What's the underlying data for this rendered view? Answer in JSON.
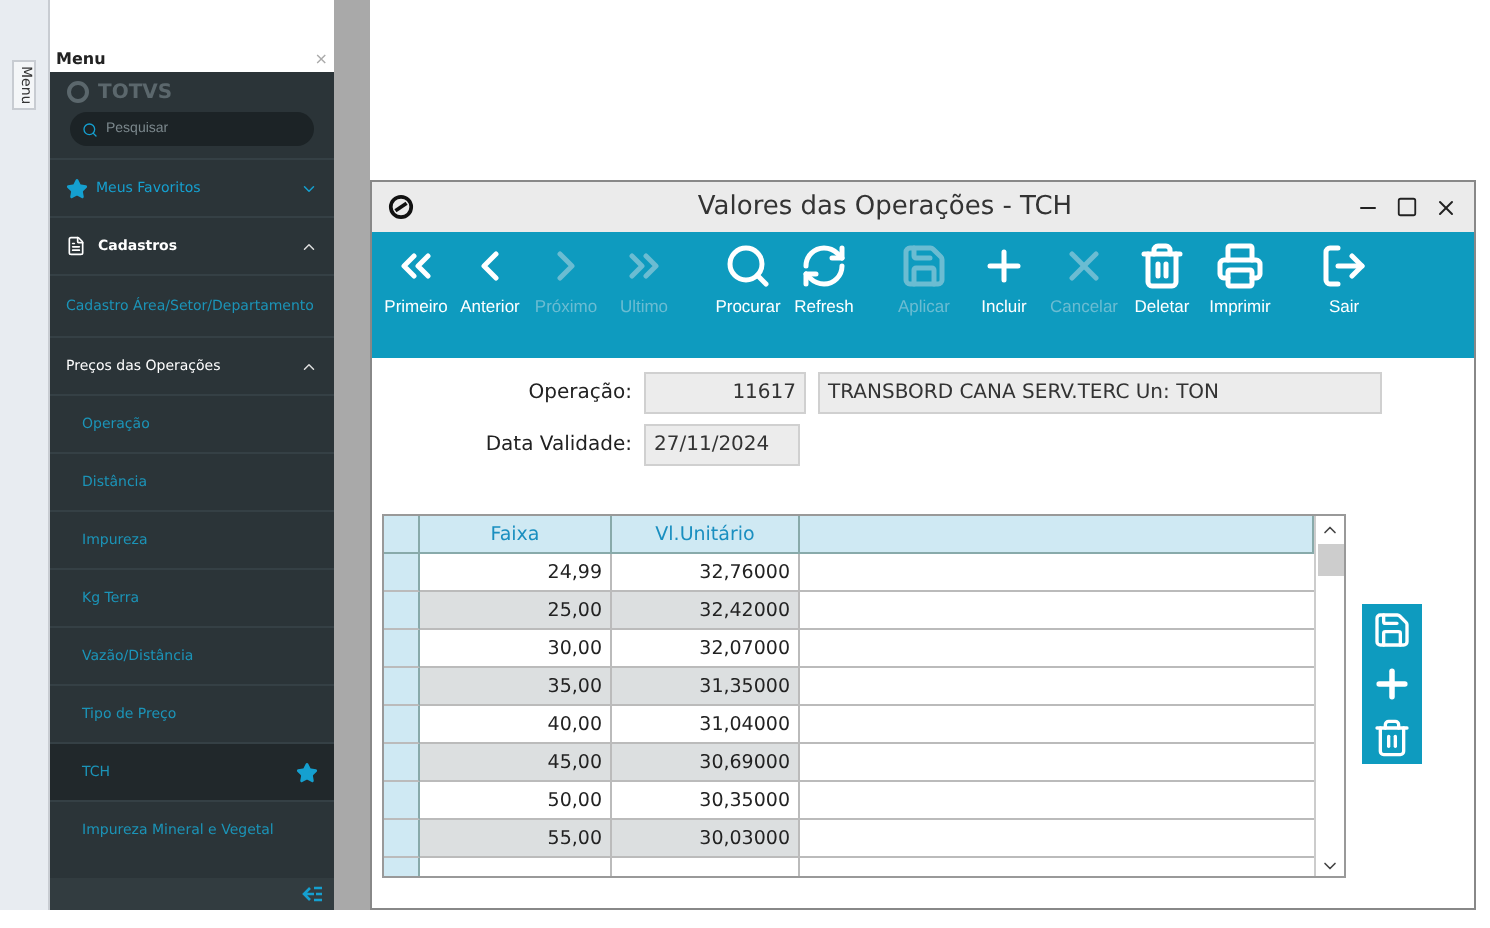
{
  "side_tab": {
    "label": "Menu"
  },
  "menu": {
    "title": "Menu",
    "close": "×",
    "logo": "TOTVS",
    "search": {
      "placeholder": "Pesquisar"
    },
    "items": [
      {
        "kind": "favorites",
        "label": "Meus Favoritos",
        "expanded": false
      },
      {
        "kind": "group",
        "label": "Cadastros",
        "expanded": true
      },
      {
        "kind": "link",
        "label": "Cadastro Área/Setor/Departamento",
        "selected": false,
        "favorite": false
      },
      {
        "kind": "section",
        "label": "Preços das Operações",
        "expanded": true
      },
      {
        "kind": "link",
        "label": "Operação",
        "selected": false,
        "favorite": false
      },
      {
        "kind": "link",
        "label": "Distância",
        "selected": false,
        "favorite": false
      },
      {
        "kind": "link",
        "label": "Impureza",
        "selected": false,
        "favorite": false
      },
      {
        "kind": "link",
        "label": "Kg Terra",
        "selected": false,
        "favorite": false
      },
      {
        "kind": "link",
        "label": "Vazão/Distância",
        "selected": false,
        "favorite": false
      },
      {
        "kind": "link",
        "label": "Tipo de Preço",
        "selected": false,
        "favorite": false
      },
      {
        "kind": "link",
        "label": "TCH",
        "selected": true,
        "favorite": true
      },
      {
        "kind": "link",
        "label": "Impureza Mineral e Vegetal",
        "selected": false,
        "favorite": false
      }
    ]
  },
  "window": {
    "title": "Valores das Operações - TCH"
  },
  "toolbar": [
    {
      "label": "Primeiro",
      "disabled": false
    },
    {
      "label": "Anterior",
      "disabled": false
    },
    {
      "label": "Próximo",
      "disabled": true
    },
    {
      "label": "Ultimo",
      "disabled": true
    },
    {
      "label": "Procurar",
      "disabled": false
    },
    {
      "label": "Refresh",
      "disabled": false
    },
    {
      "label": "Aplicar",
      "disabled": true
    },
    {
      "label": "Incluir",
      "disabled": false
    },
    {
      "label": "Cancelar",
      "disabled": true
    },
    {
      "label": "Deletar",
      "disabled": false
    },
    {
      "label": "Imprimir",
      "disabled": false
    },
    {
      "label": "Sair",
      "disabled": false
    }
  ],
  "form": {
    "operacao": {
      "label": "Operação:",
      "code": "11617",
      "description": "TRANSBORD CANA SERV.TERC Un: TON"
    },
    "data_validade": {
      "label": "Data Validade:",
      "value": "27/11/2024"
    }
  },
  "table": {
    "columns": [
      "Faixa",
      "Vl.Unitário"
    ],
    "rows": [
      [
        "24,99",
        "32,76000"
      ],
      [
        "25,00",
        "32,42000"
      ],
      [
        "30,00",
        "32,07000"
      ],
      [
        "35,00",
        "31,35000"
      ],
      [
        "40,00",
        "31,04000"
      ],
      [
        "45,00",
        "30,69000"
      ],
      [
        "50,00",
        "30,35000"
      ],
      [
        "55,00",
        "30,03000"
      ]
    ]
  }
}
